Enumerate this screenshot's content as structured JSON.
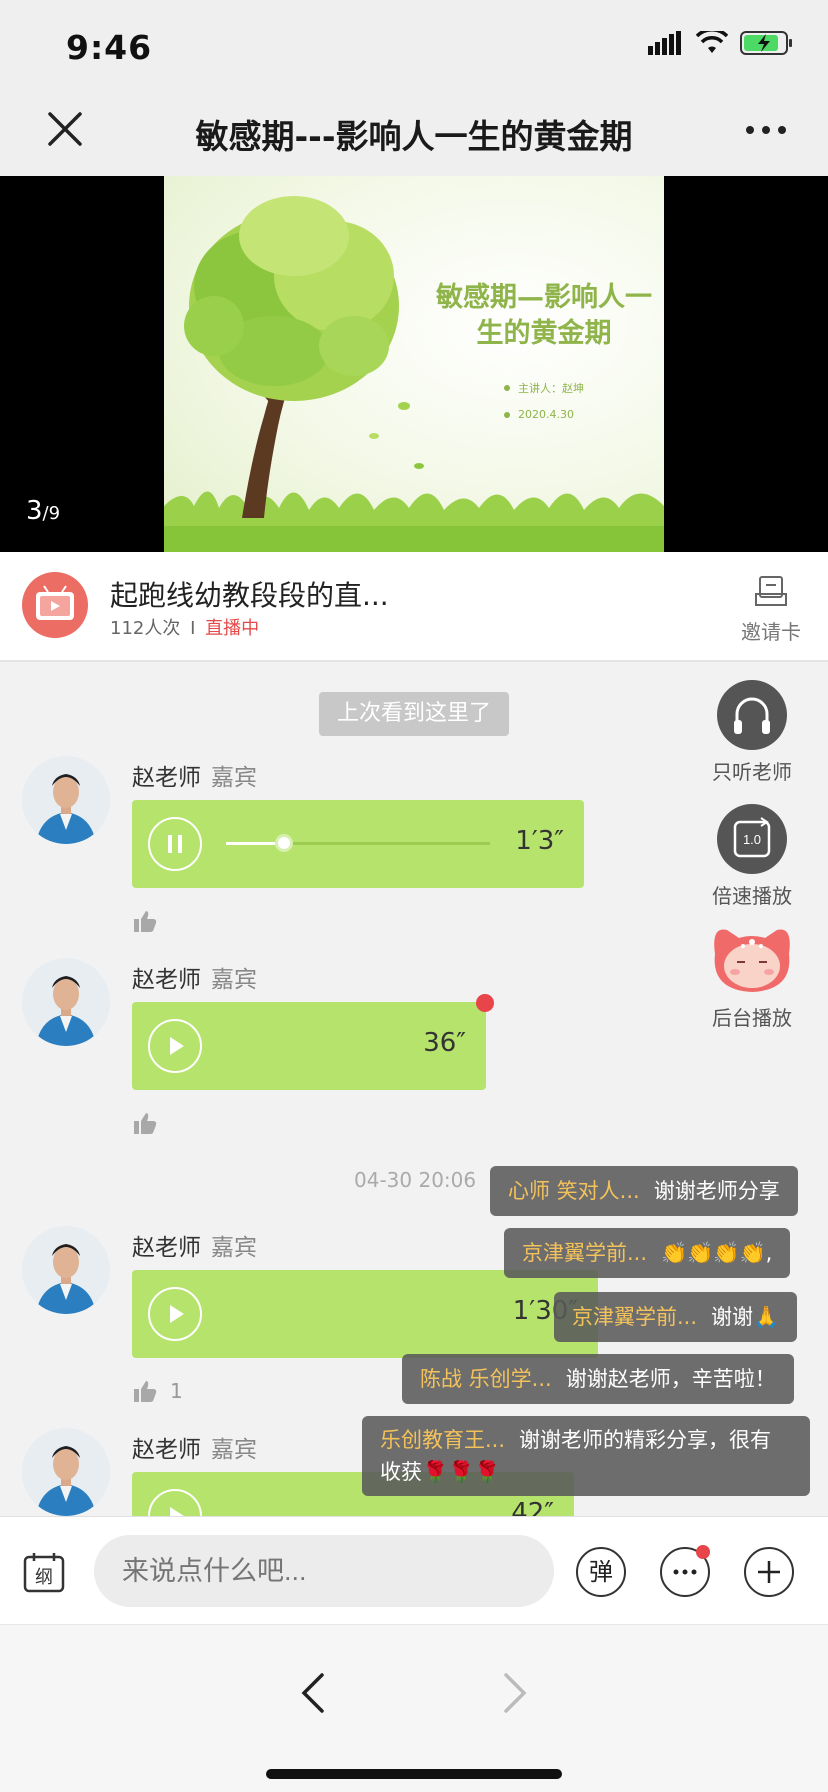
{
  "status": {
    "time": "9:46"
  },
  "nav": {
    "title": "敏感期---影响人一生的黄金期"
  },
  "slide": {
    "title": "敏感期—影响人一生的黄金期",
    "bullets": [
      "主讲人：赵坤",
      "2020.4.30"
    ],
    "page_current": "3",
    "page_total": "9"
  },
  "channel": {
    "name": "起跑线幼教段段的直...",
    "views": "112人次",
    "separator": "I",
    "status": "直播中",
    "invite_label": "邀请卡"
  },
  "chat": {
    "last_seen_label": "上次看到这里了",
    "messages": [
      {
        "sender": "赵老师",
        "role": "嘉宾",
        "duration": "1′3″",
        "playing": true,
        "progress": 0.22,
        "likes": ""
      },
      {
        "sender": "赵老师",
        "role": "嘉宾",
        "duration": "36″",
        "playing": false,
        "unread": true,
        "likes": ""
      },
      {
        "sender": "赵老师",
        "role": "嘉宾",
        "duration": "1′30″",
        "playing": false,
        "likes": "1"
      },
      {
        "sender": "赵老师",
        "role": "嘉宾",
        "duration": "42″",
        "playing": false,
        "likes": ""
      }
    ],
    "timestamp": "04-30 20:06"
  },
  "float_buttons": {
    "listen_teacher": "只听老师",
    "speed": "倍速播放",
    "speed_value": "1.0",
    "background": "后台播放"
  },
  "danmaku": [
    {
      "name": "心师 笑对人...",
      "text": "谢谢老师分享"
    },
    {
      "name": "京津翼学前...",
      "text": "👏👏👏👏,"
    },
    {
      "name": "京津翼学前...",
      "text": "谢谢🙏"
    },
    {
      "name": "陈战 乐创学...",
      "text": "谢谢赵老师，辛苦啦！"
    },
    {
      "name": "乐创教育王...",
      "text": "谢谢老师的精彩分享，很有收获🌹🌹🌹"
    }
  ],
  "input": {
    "outline_label": "纲",
    "placeholder": "来说点什么吧...",
    "danmaku_toggle": "弹"
  },
  "colors": {
    "voice_bubble": "#b5e36b",
    "live": "#e54a4a",
    "danmaku_name": "#f4c25a",
    "badge": "#e8454b"
  }
}
